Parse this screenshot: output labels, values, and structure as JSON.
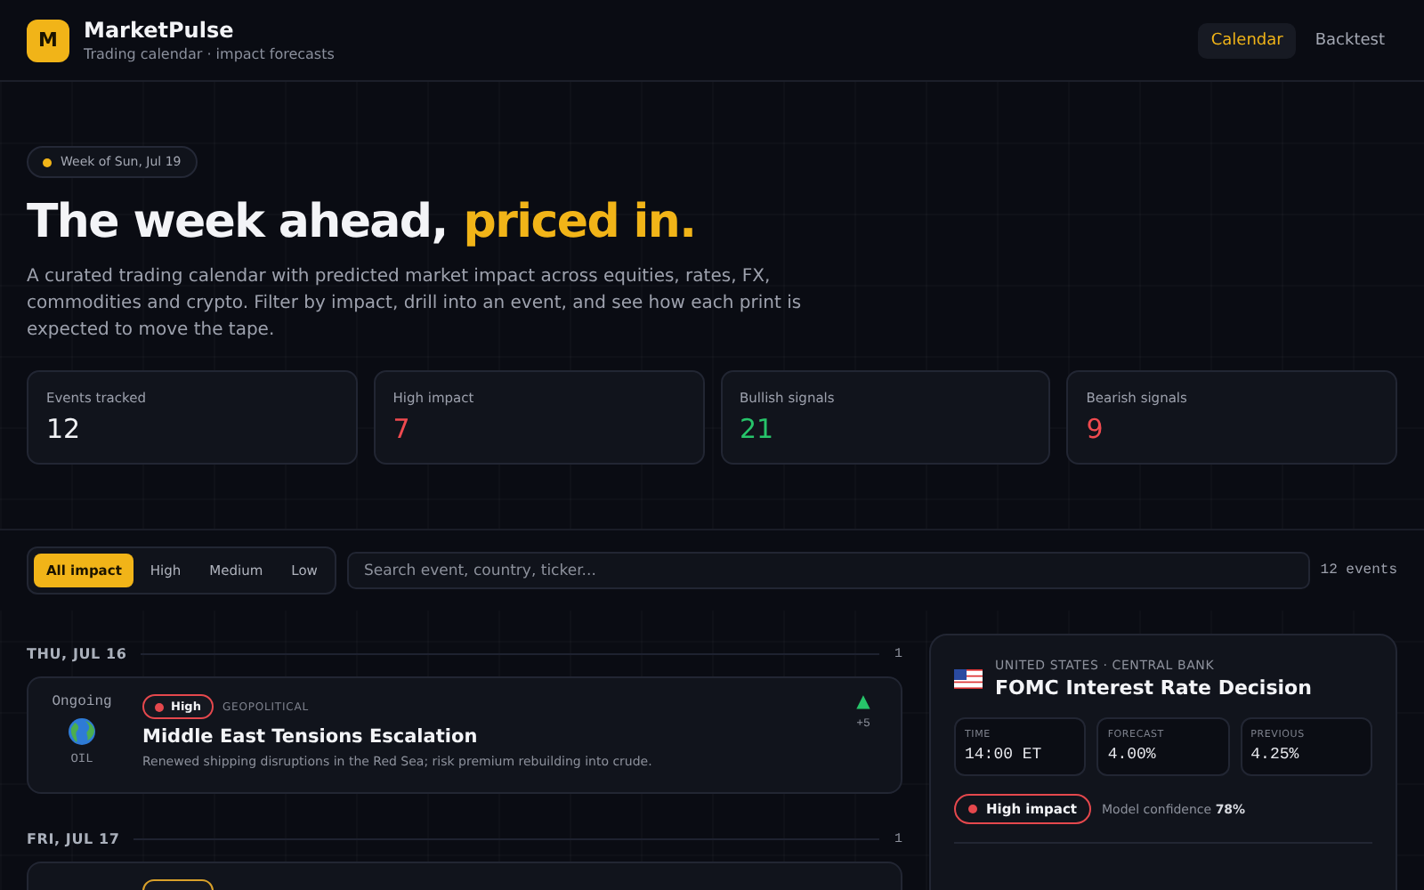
{
  "app": {
    "logo_letter": "M",
    "name": "MarketPulse",
    "tagline": "Trading calendar · impact forecasts"
  },
  "nav": [
    {
      "label": "Calendar",
      "selected": true
    },
    {
      "label": "Backtest",
      "selected": false
    }
  ],
  "hero": {
    "week_badge": "Week of Sun, Jul 19",
    "title": "The week ahead,",
    "title_highlight": "priced in.",
    "description": "A curated trading calendar with predicted market impact across equities, rates, FX, commodities and crypto. Filter by impact, drill into an event, and see how each print is expected to move the tape."
  },
  "stats": [
    {
      "label": "Events tracked",
      "value": "12",
      "color": "#f1f2f5"
    },
    {
      "label": "High impact",
      "value": "7",
      "color": "#ef4a4f"
    },
    {
      "label": "Bullish signals",
      "value": "21",
      "color": "#27c46a"
    },
    {
      "label": "Bearish signals",
      "value": "9",
      "color": "#ef4a4f"
    }
  ],
  "filters": [
    {
      "label": "All impact",
      "selected": true
    },
    {
      "label": "High",
      "selected": false
    },
    {
      "label": "Medium",
      "selected": false
    },
    {
      "label": "Low",
      "selected": false
    }
  ],
  "search": {
    "placeholder": "Search event, country, ticker..."
  },
  "event_count": "12 events",
  "days": [
    {
      "date": "THU, JUL 16",
      "count": "1",
      "events": [
        {
          "color": "#e5484d",
          "time": "Ongoing",
          "asset": "OIL",
          "impact": "High",
          "category": "GEOPOLITICAL",
          "title": "Middle East Tensions Escalation",
          "summary": "Renewed shipping disruptions in the Red Sea; risk premium rebuilding into crude.",
          "direction": "▲",
          "move": "+5"
        }
      ]
    },
    {
      "date": "FRI, JUL 17",
      "count": "1",
      "events": [
        {
          "color": "#d8a02a"
        }
      ]
    }
  ],
  "detail": {
    "country_line": "UNITED STATES · CENTRAL BANK",
    "title": "FOMC Interest Rate Decision",
    "metrics": [
      {
        "label": "TIME",
        "value": "14:00 ET"
      },
      {
        "label": "FORECAST",
        "value": "4.00%"
      },
      {
        "label": "PREVIOUS",
        "value": "4.25%"
      }
    ],
    "color": "#e5484d",
    "impact": "High impact",
    "confidence_label": "Model confidence",
    "confidence": "78%"
  }
}
